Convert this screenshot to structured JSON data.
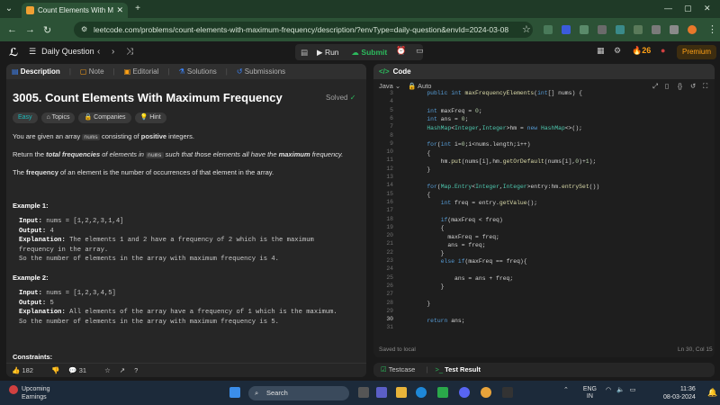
{
  "browser": {
    "tab_title": "Count Elements With Maximum",
    "url": "leetcode.com/problems/count-elements-with-maximum-frequency/description/?envType=daily-question&envId=2024-03-08",
    "minimize": "—",
    "maximize": "▢",
    "close": "✕",
    "new_tab": "+"
  },
  "lc_top": {
    "daily_question": "Daily Question",
    "run_label": "Run",
    "submit_label": "Submit",
    "streak": "26",
    "premium": "Premium"
  },
  "left_tabs": [
    "Description",
    "Note",
    "Editorial",
    "Solutions",
    "Submissions"
  ],
  "problem": {
    "title": "3005. Count Elements With Maximum Frequency",
    "status": "Solved",
    "difficulty": "Easy",
    "topics_label": "Topics",
    "companies_label": "Companies",
    "hint_label": "Hint",
    "p1_pre": "You are given an array ",
    "p1_code": "nums",
    "p1_mid": " consisting of ",
    "p1_bold": "positive",
    "p1_post": " integers.",
    "p2_pre": "Return the ",
    "p2_bold1": "total frequencies",
    "p2_mid": " of elements in ",
    "p2_code": "nums",
    "p2_mid2": " such that those elements all have the ",
    "p2_bold2": "maximum",
    "p2_post": " frequency.",
    "p3_pre": "The ",
    "p3_bold": "frequency",
    "p3_post": " of an element is the number of occurrences of that element in the array.",
    "ex1_title": "Example 1:",
    "ex1_input": "nums = [1,2,2,3,1,4]",
    "ex1_output": "4",
    "ex1_expl": "The elements 1 and 2 have a frequency of 2 which is the maximum",
    "ex1_expl2": "frequency in the array.",
    "ex1_expl3": "So the number of elements in the array with maximum frequency is 4.",
    "ex2_title": "Example 2:",
    "ex2_input": "nums = [1,2,3,4,5]",
    "ex2_output": "5",
    "ex2_expl": "All elements of the array have a frequency of 1 which is the maximum.",
    "ex2_expl2": "So the number of elements in the array with maximum frequency is 5.",
    "constraints": "Constraints:",
    "input_label": "Input:",
    "output_label": "Output:",
    "expl_label": "Explanation:"
  },
  "left_footer": {
    "likes": "182",
    "comments": "31"
  },
  "editor": {
    "header": "Code",
    "language": "Java",
    "mode": "Auto",
    "saved": "Saved to local",
    "cursor": "Ln 30, Col 15",
    "line_numbers": [
      "3",
      "4",
      "5",
      "6",
      "7",
      "8",
      "9",
      "10",
      "11",
      "12",
      "13",
      "14",
      "15",
      "16",
      "17",
      "18",
      "19",
      "20",
      "21",
      "22",
      "23",
      "24",
      "25",
      "26",
      "27",
      "28",
      "29",
      "30",
      "31"
    ]
  },
  "bottom_tabs": {
    "testcase": "Testcase",
    "result": "Test Result"
  },
  "taskbar": {
    "weather_title": "Upcoming",
    "weather_sub": "Earnings",
    "search": "Search",
    "lang": "ENG",
    "region": "IN",
    "time": "11:36",
    "date": "08-03-2024"
  }
}
